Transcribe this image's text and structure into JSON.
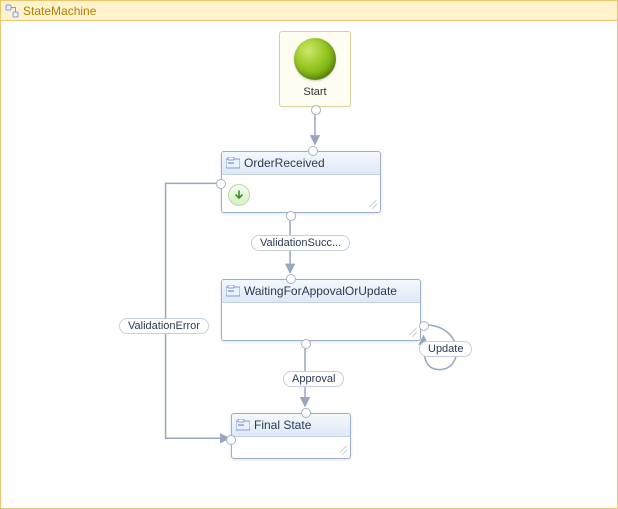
{
  "title": "StateMachine",
  "start": {
    "label": "Start"
  },
  "states": {
    "orderReceived": {
      "title": "OrderReceived"
    },
    "waiting": {
      "title": "WaitingForAppovalOrUpdate"
    },
    "final": {
      "title": "Final State"
    }
  },
  "transitions": {
    "validationSuccess": {
      "label": "ValidationSucc..."
    },
    "validationError": {
      "label": "ValidationError"
    },
    "approval": {
      "label": "Approval"
    },
    "update": {
      "label": "Update"
    }
  }
}
